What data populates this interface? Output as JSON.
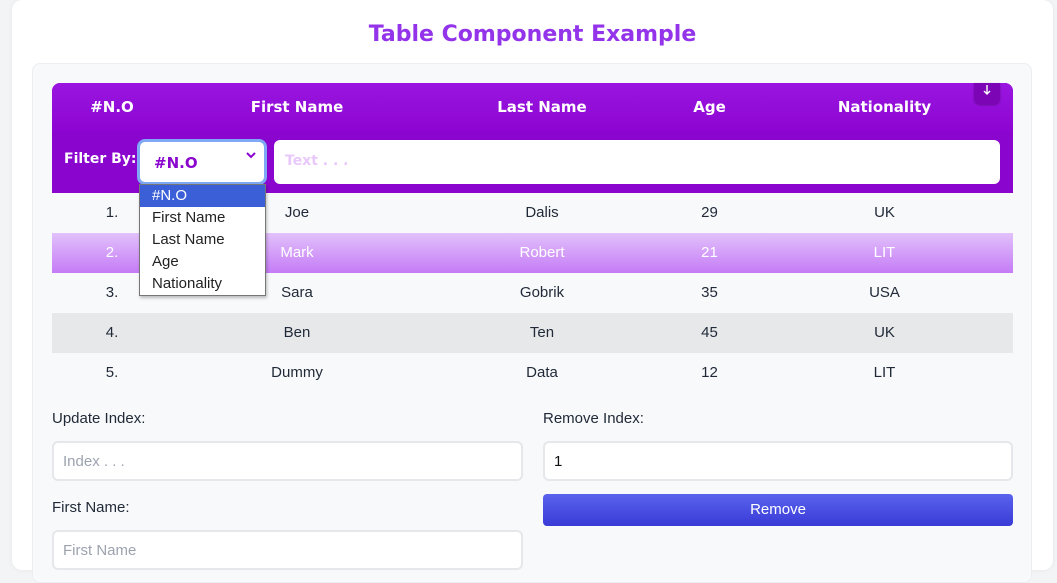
{
  "title": "Table Component Example",
  "table": {
    "headers": [
      "#N.O",
      "First Name",
      "Last Name",
      "Age",
      "Nationality"
    ],
    "filter": {
      "label": "Filter By:",
      "selected": "#N.O",
      "placeholder": "Text . . .",
      "sort_icon": "arrow-down-icon",
      "options": [
        "#N.O",
        "First Name",
        "Last Name",
        "Age",
        "Nationality"
      ]
    },
    "rows": [
      [
        "1.",
        "Joe",
        "Dalis",
        "29",
        "UK"
      ],
      [
        "2.",
        "Mark",
        "Robert",
        "21",
        "LIT"
      ],
      [
        "3.",
        "Sara",
        "Gobrik",
        "35",
        "USA"
      ],
      [
        "4.",
        "Ben",
        "Ten",
        "45",
        "UK"
      ],
      [
        "5.",
        "Dummy",
        "Data",
        "12",
        "LIT"
      ]
    ]
  },
  "form": {
    "update_label": "Update Index:",
    "update_placeholder": "Index . . .",
    "remove_label": "Remove Index:",
    "remove_value": "1",
    "first_name_label": "First Name:",
    "first_name_placeholder": "First Name",
    "remove_button": "Remove"
  },
  "colors": {
    "accent": "#9333ea",
    "header": "#8f06d6",
    "highlight_row": "#c57bf6",
    "button": "#4f46e5"
  }
}
